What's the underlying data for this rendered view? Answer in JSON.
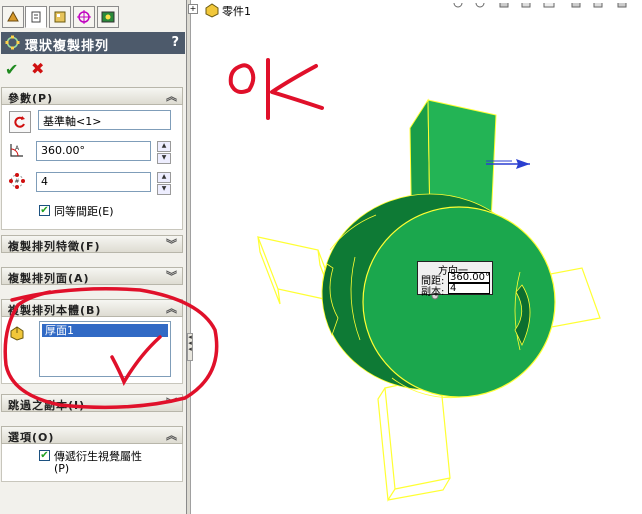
{
  "feature_tabs": [
    "feature-manager-icon",
    "property-manager-icon",
    "configuration-manager-icon",
    "dimxpert-icon",
    "display-manager-icon"
  ],
  "property_manager": {
    "title": "環狀複製排列",
    "help": "?",
    "ok_icon": "check-icon",
    "cancel_icon": "x-icon"
  },
  "parameters": {
    "header": "參數(P)",
    "axis_value": "基準軸<1>",
    "angle_value": "360.00°",
    "count_value": "4",
    "equal_spacing_label": "同等間距(E)",
    "equal_spacing_checked": true
  },
  "sections": {
    "features": "複製排列特徵(F)",
    "faces": "複製排列面(A)",
    "bodies": "複製排列本體(B)",
    "skip": "跳過之副本(I)",
    "options": "選項(O)"
  },
  "bodies_list": [
    "厚面1"
  ],
  "options": {
    "propagate_label_line1": "傳遞衍生視覺屬性",
    "propagate_label_line2": "(P)",
    "propagate_checked": true
  },
  "tree": {
    "part_name": "零件1"
  },
  "callout": {
    "title": "方向一",
    "spacing_label": "間距:",
    "spacing_value": "360.00°",
    "instances_label": "副本:",
    "instances_value": "4"
  },
  "annotations": {
    "handwritten_ok": "oK"
  },
  "colors": {
    "model_green": "#1aa04a",
    "model_green_dark": "#0e7a35",
    "preview_yellow": "#ffff33",
    "annotation_red": "#e0102a",
    "title_bar": "#4d5a6b"
  }
}
